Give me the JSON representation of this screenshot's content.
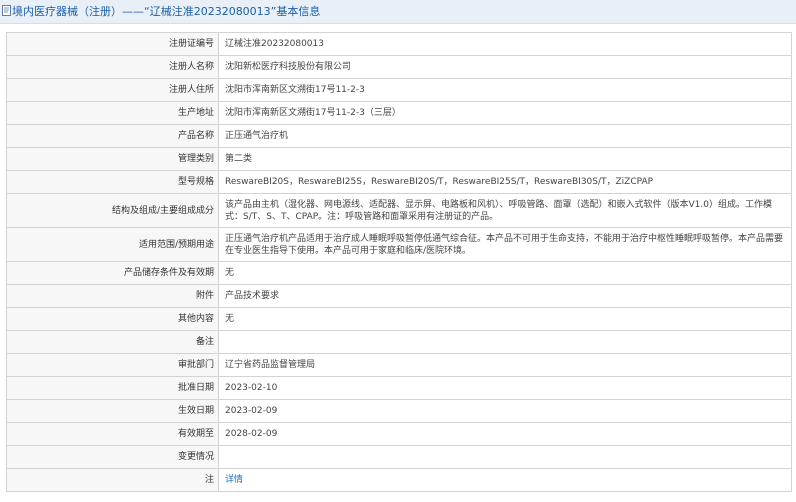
{
  "header": {
    "title": "境内医疗器械（注册）——“辽械注准20232080013”基本信息"
  },
  "rows": [
    {
      "label": "注册证编号",
      "value": "辽械注准20232080013"
    },
    {
      "label": "注册人名称",
      "value": "沈阳新松医疗科技股份有限公司"
    },
    {
      "label": "注册人住所",
      "value": "沈阳市浑南新区文溯街17号11-2-3"
    },
    {
      "label": "生产地址",
      "value": "沈阳市浑南新区文溯街17号11-2-3（三层）"
    },
    {
      "label": "产品名称",
      "value": "正压通气治疗机"
    },
    {
      "label": "管理类别",
      "value": "第二类"
    },
    {
      "label": "型号规格",
      "value": "ReswareBI20S，ReswareBI25S，ReswareBI20S/T，ReswareBI25S/T，ReswareBI30S/T，ZiZCPAP"
    },
    {
      "label": "结构及组成/主要组成成分",
      "value": "该产品由主机（湿化器、网电源线、适配器、显示屏、电路板和风机）、呼吸管路、面罩（选配）和嵌入式软件（版本V1.0）组成。工作模式：S/T、S、T、CPAP。注：呼吸管路和面罩采用有注册证的产品。"
    },
    {
      "label": "适用范围/预期用途",
      "value": "正压通气治疗机产品适用于治疗成人睡眠呼吸暂停低通气综合征。本产品不可用于生命支持，不能用于治疗中枢性睡眠呼吸暂停。本产品需要在专业医生指导下使用。本产品可用于家庭和临床/医院环境。"
    },
    {
      "label": "产品储存条件及有效期",
      "value": "无"
    },
    {
      "label": "附件",
      "value": "产品技术要求"
    },
    {
      "label": "其他内容",
      "value": "无"
    },
    {
      "label": "备注",
      "value": ""
    },
    {
      "label": "审批部门",
      "value": "辽宁省药品监督管理局"
    },
    {
      "label": "批准日期",
      "value": "2023-02-10"
    },
    {
      "label": "生效日期",
      "value": "2023-02-09"
    },
    {
      "label": "有效期至",
      "value": "2028-02-09"
    },
    {
      "label": "变更情况",
      "value": ""
    },
    {
      "label": "注",
      "value": "详情"
    }
  ],
  "colors": {
    "header_bg": "#e9eff6",
    "title": "#1b5fa8",
    "label_bg": "#f7f7f7",
    "border": "#d3d3d3",
    "link": "#1b6fc4"
  },
  "icons": {
    "header": "document-icon"
  }
}
